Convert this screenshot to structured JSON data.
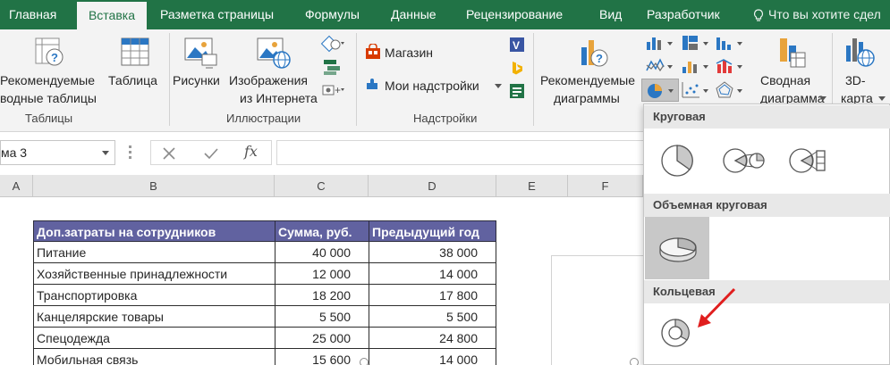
{
  "tabs": [
    "Главная",
    "Вставка",
    "Разметка страницы",
    "Формулы",
    "Данные",
    "Рецензирование",
    "Вид",
    "Разработчик"
  ],
  "active_tab": "Вставка",
  "tell_me": "Что вы хотите сдел",
  "ribbon": {
    "recommended_pivot": {
      "line1": "Рекомендуемые",
      "line2": "водные таблицы"
    },
    "table": "Таблица",
    "pictures": "Рисунки",
    "online_pictures": {
      "line1": "Изображения",
      "line2": "из Интернета"
    },
    "store": "Магазин",
    "my_addins": "Мои надстройки",
    "recommended_charts": {
      "line1": "Рекомендуемые",
      "line2": "диаграммы"
    },
    "pivot_chart": {
      "line1": "Сводная",
      "line2": "диаграмма"
    },
    "map_3d": {
      "line1": "3D-",
      "line2": "карта"
    },
    "groups": {
      "tables": "Таблицы",
      "illustrations": "Иллюстрации",
      "addins": "Надстройки"
    }
  },
  "formula_bar": {
    "name_box": "ма 3",
    "fx": "fx"
  },
  "columns": [
    "A",
    "B",
    "C",
    "D",
    "E",
    "F"
  ],
  "table": {
    "headers": [
      "Доп.затраты на сотрудников",
      "Сумма, руб.",
      "Предыдущий год"
    ],
    "rows": [
      [
        "Питание",
        "40 000",
        "38 000"
      ],
      [
        "Хозяйственные принадлежности",
        "12 000",
        "14 000"
      ],
      [
        "Транспортировка",
        "18 200",
        "17 800"
      ],
      [
        "Канцелярские товары",
        "5 500",
        "5 500"
      ],
      [
        "Спецодежда",
        "25 000",
        "24 800"
      ],
      [
        "Мобильная связь",
        "15 600",
        "14 000"
      ]
    ]
  },
  "dropdown": {
    "sections": [
      "Круговая",
      "Объемная круговая",
      "Кольцевая"
    ]
  },
  "colors": {
    "excel_green": "#217346",
    "table_header": "#6162a0",
    "arrow_red": "#e01e1e"
  }
}
